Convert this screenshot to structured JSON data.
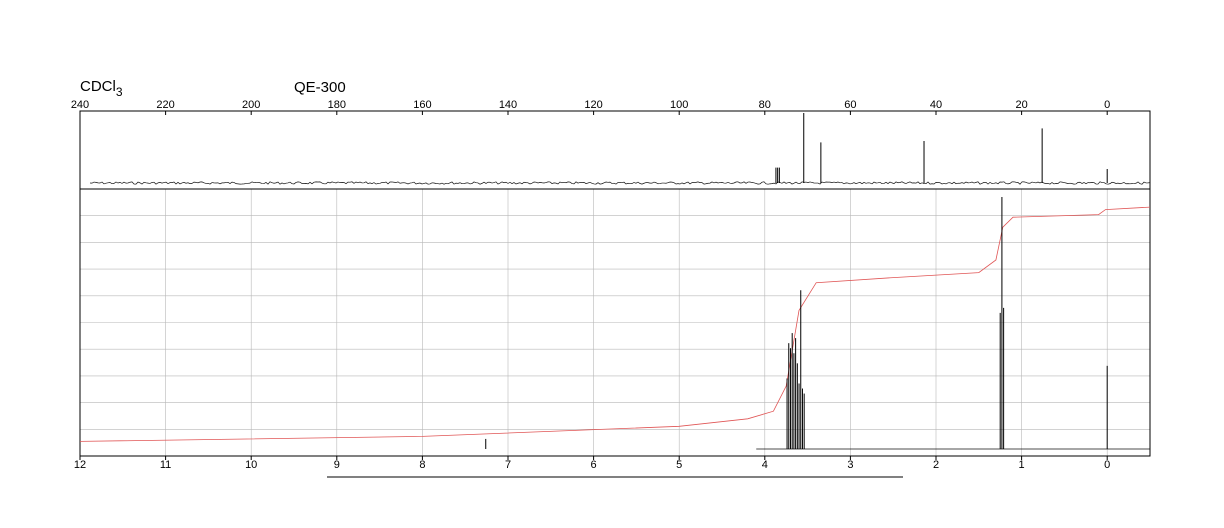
{
  "header": {
    "solvent": "CDCl",
    "solvent_subscript": "3",
    "instrument": "QE-300"
  },
  "chart_data": [
    {
      "type": "line",
      "kind": "13C NMR spectrum",
      "x_ticks": [
        240,
        220,
        200,
        180,
        160,
        140,
        120,
        100,
        80,
        60,
        40,
        20,
        0
      ],
      "x_tick_labels": [
        "240",
        "220",
        "200",
        "180",
        "160",
        "140",
        "120",
        "100",
        "80",
        "60",
        "40",
        "20",
        "0"
      ],
      "xlim": [
        240,
        -10
      ],
      "x_reversed": true,
      "grid": false,
      "peaks": [
        {
          "x": 77.4,
          "y": 0.22
        },
        {
          "x": 77.0,
          "y": 0.22
        },
        {
          "x": 76.6,
          "y": 0.22
        },
        {
          "x": 70.9,
          "y": 1.0
        },
        {
          "x": 66.9,
          "y": 0.58
        },
        {
          "x": 42.8,
          "y": 0.6
        },
        {
          "x": 15.2,
          "y": 0.78
        },
        {
          "x": 0.0,
          "y": 0.2
        }
      ]
    },
    {
      "type": "line",
      "kind": "1H NMR spectrum",
      "x_ticks": [
        12,
        11,
        10,
        9,
        8,
        7,
        6,
        5,
        4,
        3,
        2,
        1,
        0
      ],
      "x_tick_labels": [
        "12",
        "11",
        "10",
        "9",
        "8",
        "7",
        "6",
        "5",
        "4",
        "3",
        "2",
        "1",
        "0"
      ],
      "xlim": [
        12,
        -0.5
      ],
      "x_reversed": true,
      "grid": true,
      "peaks": [
        {
          "x": 3.74,
          "y": 0.28
        },
        {
          "x": 3.72,
          "y": 0.42
        },
        {
          "x": 3.7,
          "y": 0.4
        },
        {
          "x": 3.68,
          "y": 0.46
        },
        {
          "x": 3.66,
          "y": 0.38
        },
        {
          "x": 3.64,
          "y": 0.44
        },
        {
          "x": 3.62,
          "y": 0.34
        },
        {
          "x": 3.6,
          "y": 0.26
        },
        {
          "x": 3.58,
          "y": 0.63
        },
        {
          "x": 3.56,
          "y": 0.24
        },
        {
          "x": 3.54,
          "y": 0.22
        },
        {
          "x": 1.25,
          "y": 0.54
        },
        {
          "x": 1.23,
          "y": 1.0
        },
        {
          "x": 1.21,
          "y": 0.56
        },
        {
          "x": 7.26,
          "y": 0.04
        },
        {
          "x": 0.0,
          "y": 0.33
        }
      ],
      "integration_curve": [
        {
          "x": 12.0,
          "y": 0.03
        },
        {
          "x": 8.0,
          "y": 0.05
        },
        {
          "x": 5.0,
          "y": 0.09
        },
        {
          "x": 4.2,
          "y": 0.12
        },
        {
          "x": 3.9,
          "y": 0.15
        },
        {
          "x": 3.75,
          "y": 0.25
        },
        {
          "x": 3.6,
          "y": 0.55
        },
        {
          "x": 3.4,
          "y": 0.66
        },
        {
          "x": 2.5,
          "y": 0.68
        },
        {
          "x": 1.5,
          "y": 0.7
        },
        {
          "x": 1.3,
          "y": 0.75
        },
        {
          "x": 1.22,
          "y": 0.88
        },
        {
          "x": 1.1,
          "y": 0.92
        },
        {
          "x": 0.1,
          "y": 0.93
        },
        {
          "x": 0.02,
          "y": 0.95
        },
        {
          "x": -0.5,
          "y": 0.96
        }
      ],
      "integration_color": "#e05555"
    }
  ]
}
